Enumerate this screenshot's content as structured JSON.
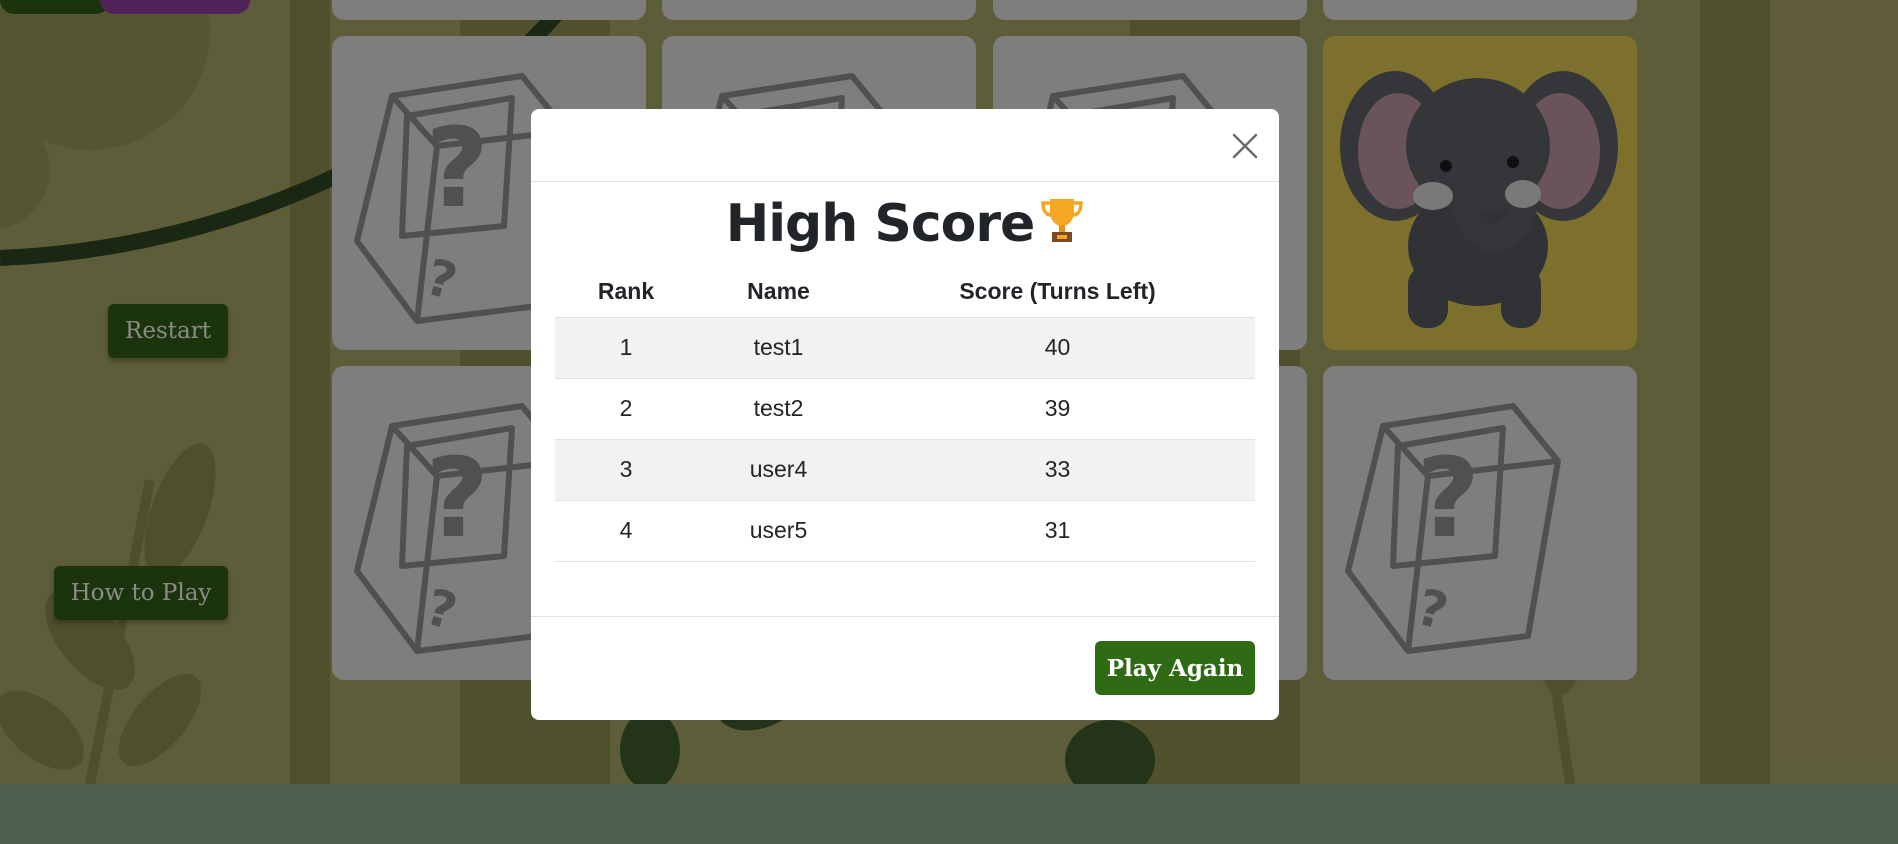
{
  "sidebar": {
    "restart_label": "Restart",
    "how_to_play_label": "How to Play"
  },
  "board": {
    "cards": [
      {
        "state": "hidden",
        "icon": "mystery-box-icon"
      },
      {
        "state": "hidden",
        "icon": "mystery-box-icon"
      },
      {
        "state": "hidden",
        "icon": "mystery-box-icon"
      },
      {
        "state": "revealed",
        "icon": "elephant-icon"
      },
      {
        "state": "hidden",
        "icon": "mystery-box-icon"
      },
      {
        "state": "hidden",
        "icon": "mystery-box-icon"
      },
      {
        "state": "hidden",
        "icon": "mystery-box-icon"
      },
      {
        "state": "hidden",
        "icon": "mystery-box-icon"
      }
    ]
  },
  "modal": {
    "title": "High Score",
    "title_icon": "trophy-icon",
    "close_icon": "close-icon",
    "columns": [
      "Rank",
      "Name",
      "Score (Turns Left)"
    ],
    "rows": [
      {
        "rank": "1",
        "name": "test1",
        "score": "40"
      },
      {
        "rank": "2",
        "name": "test2",
        "score": "39"
      },
      {
        "rank": "3",
        "name": "user4",
        "score": "33"
      },
      {
        "rank": "4",
        "name": "user5",
        "score": "31"
      }
    ],
    "play_again_label": "Play Again"
  },
  "colors": {
    "background": "#a3a164",
    "button_green": "#2f6a15",
    "card_hidden": "#d9d9d9",
    "card_revealed": "#d6c24c",
    "footer": "#87a48c"
  }
}
